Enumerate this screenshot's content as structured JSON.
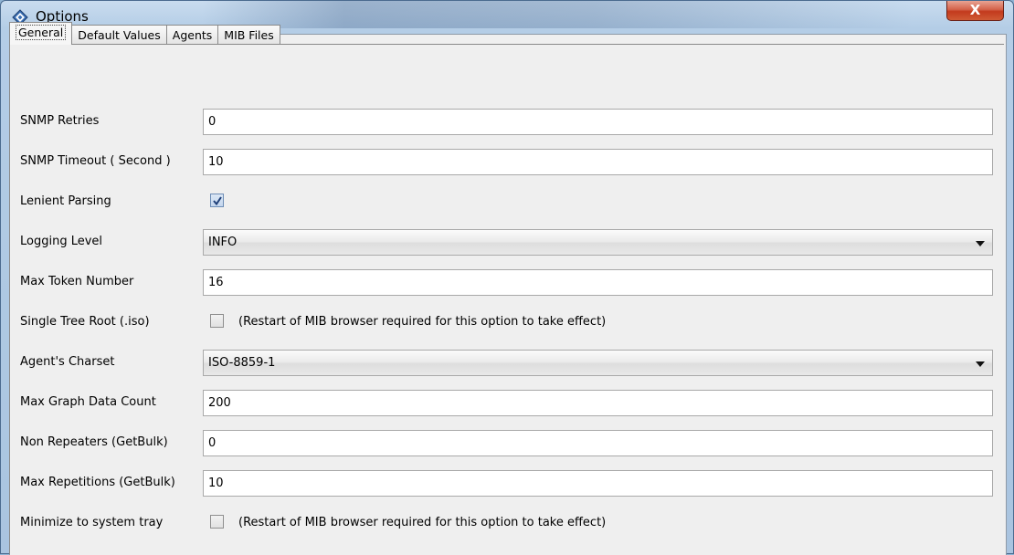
{
  "window": {
    "title": "Options",
    "close_label": "X",
    "icon": "diamond-app-icon"
  },
  "tabs": [
    {
      "label": "General",
      "active": true
    },
    {
      "label": "Default Values",
      "active": false
    },
    {
      "label": "Agents",
      "active": false
    },
    {
      "label": "MIB Files",
      "active": false
    }
  ],
  "general": {
    "snmp_retries": {
      "label": "SNMP Retries",
      "value": "0"
    },
    "snmp_timeout": {
      "label": "SNMP Timeout ( Second )",
      "value": "10"
    },
    "lenient_parsing": {
      "label": "Lenient Parsing",
      "checked": true
    },
    "logging_level": {
      "label": "Logging Level",
      "value": "INFO"
    },
    "max_token_number": {
      "label": "Max Token Number",
      "value": "16"
    },
    "single_tree_root": {
      "label": "Single Tree Root (.iso)",
      "checked": false,
      "note": "(Restart of MIB browser required for this option to take effect)"
    },
    "agents_charset": {
      "label": "Agent's Charset",
      "value": "ISO-8859-1"
    },
    "max_graph_data_count": {
      "label": "Max Graph Data Count",
      "value": "200"
    },
    "non_repeaters": {
      "label": "Non Repeaters (GetBulk)",
      "value": "0"
    },
    "max_repetitions": {
      "label": "Max Repetitions (GetBulk)",
      "value": "10"
    },
    "minimize_to_tray": {
      "label": "Minimize to system tray",
      "checked": false,
      "note": "(Restart of MIB browser required for this option to take effect)"
    }
  },
  "colors": {
    "title_bar": "#b4cde6",
    "close_button": "#c33a1d",
    "panel_background": "#efefef",
    "field_border": "#a9a9a9"
  }
}
